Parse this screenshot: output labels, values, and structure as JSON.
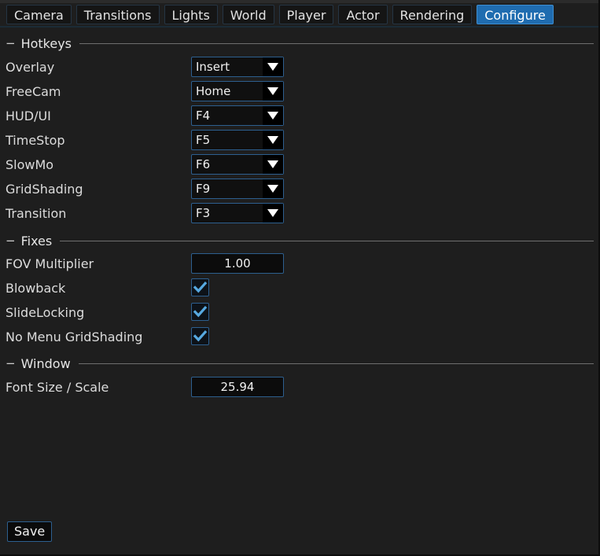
{
  "tabs": [
    {
      "label": "Camera",
      "active": false
    },
    {
      "label": "Transitions",
      "active": false
    },
    {
      "label": "Lights",
      "active": false
    },
    {
      "label": "World",
      "active": false
    },
    {
      "label": "Player",
      "active": false
    },
    {
      "label": "Actor",
      "active": false
    },
    {
      "label": "Rendering",
      "active": false
    },
    {
      "label": "Configure",
      "active": true
    }
  ],
  "sections": {
    "hotkeys": {
      "title": "Hotkeys",
      "collapse_glyph": "−"
    },
    "fixes": {
      "title": "Fixes",
      "collapse_glyph": "−"
    },
    "window": {
      "title": "Window",
      "collapse_glyph": "−"
    }
  },
  "hotkeys": [
    {
      "label": "Overlay",
      "value": "Insert"
    },
    {
      "label": "FreeCam",
      "value": "Home"
    },
    {
      "label": "HUD/UI",
      "value": "F4"
    },
    {
      "label": "TimeStop",
      "value": "F5"
    },
    {
      "label": "SlowMo",
      "value": "F6"
    },
    {
      "label": "GridShading",
      "value": "F9"
    },
    {
      "label": "Transition",
      "value": "F3"
    }
  ],
  "fixes": {
    "fov": {
      "label": "FOV Multiplier",
      "value": "1.00"
    },
    "toggles": [
      {
        "label": "Blowback",
        "checked": true
      },
      {
        "label": "SlideLocking",
        "checked": true
      },
      {
        "label": "No Menu GridShading",
        "checked": true
      }
    ]
  },
  "window_section": {
    "font_scale": {
      "label": "Font Size / Scale",
      "value": "25.94"
    }
  },
  "actions": {
    "save_label": "Save"
  },
  "colors": {
    "background": "#1e1e1e",
    "accent_blue": "#1f6cb0",
    "border_blue": "#2d5f8f",
    "check_blue": "#57a9e0",
    "text": "#dcdcdc",
    "rule": "#6f6f6f"
  },
  "icons": {
    "dropdown_caret": "chevron-down-icon",
    "checkmark": "check-icon",
    "collapse": "minus-icon"
  }
}
